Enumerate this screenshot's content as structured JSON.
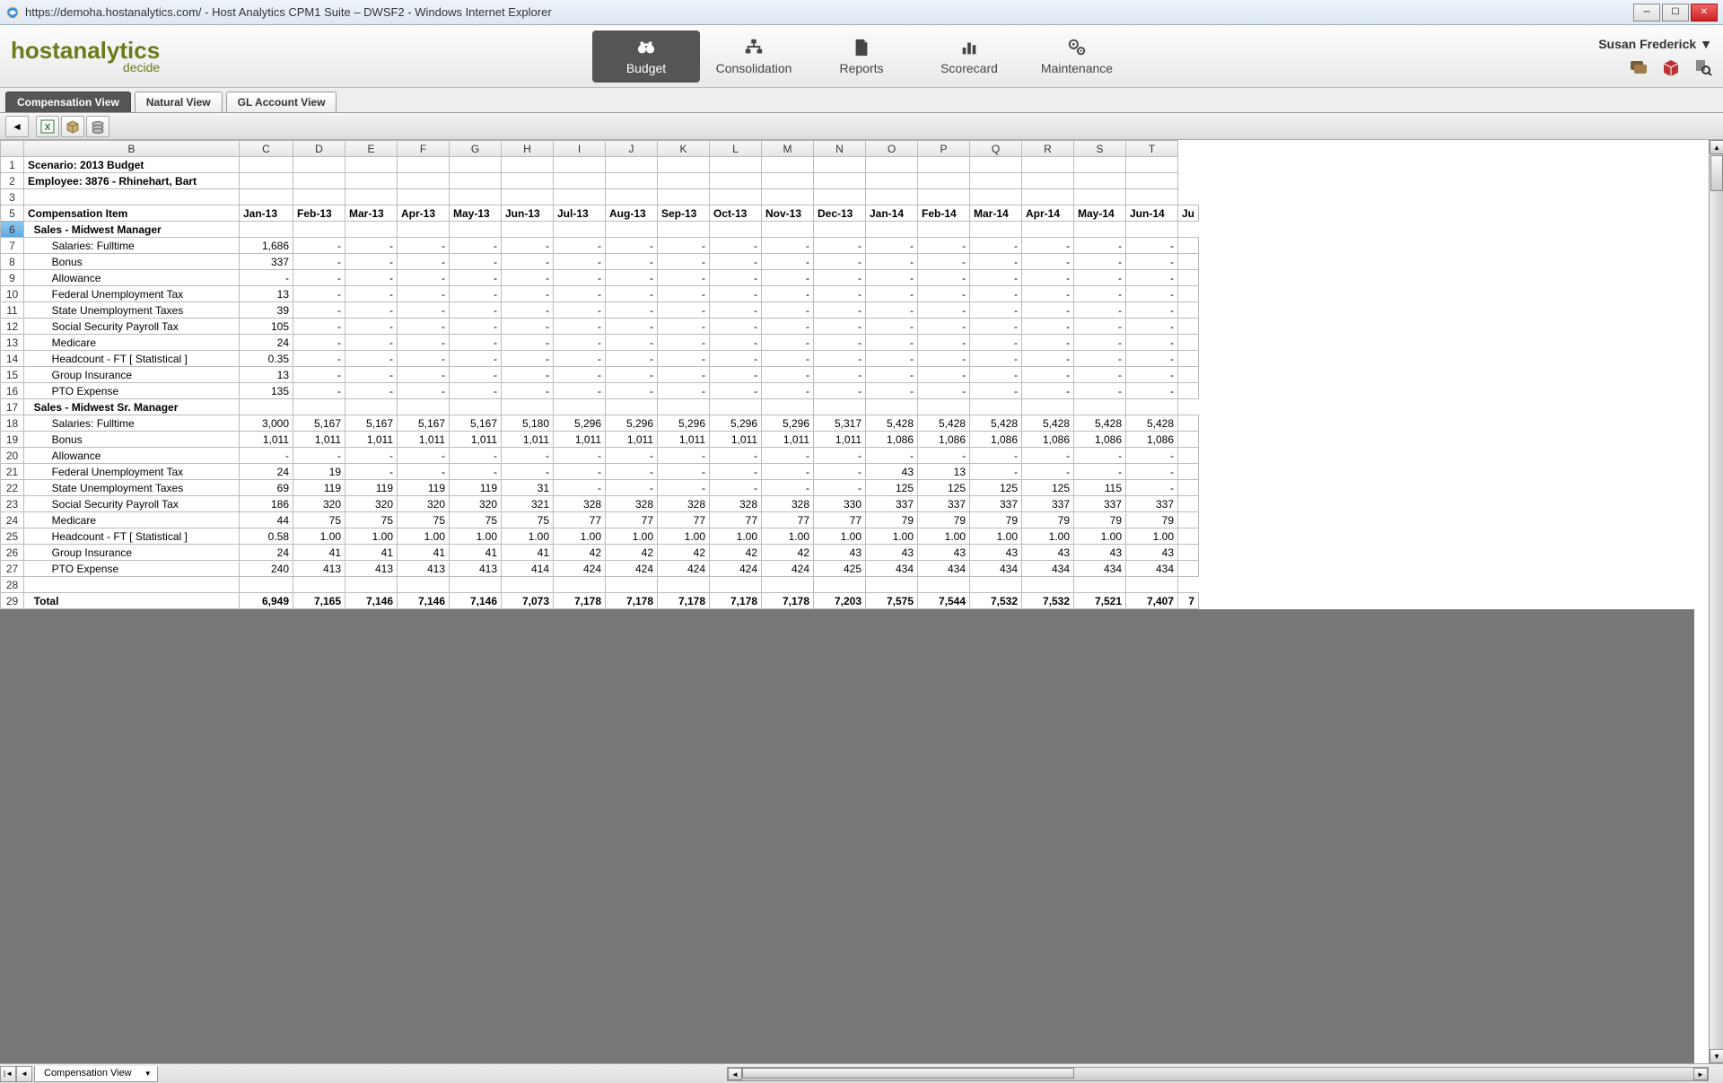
{
  "window": {
    "title": "https://demoha.hostanalytics.com/ - Host Analytics CPM1 Suite – DWSF2 - Windows Internet Explorer"
  },
  "logo": {
    "main": "hostanalytics",
    "sub": "decide"
  },
  "nav": {
    "items": [
      {
        "label": "Budget",
        "icon": "binoculars"
      },
      {
        "label": "Consolidation",
        "icon": "org"
      },
      {
        "label": "Reports",
        "icon": "doc"
      },
      {
        "label": "Scorecard",
        "icon": "chart"
      },
      {
        "label": "Maintenance",
        "icon": "gears"
      }
    ],
    "active": 0
  },
  "user": {
    "name": "Susan Frederick"
  },
  "tabs": {
    "items": [
      "Compensation View",
      "Natural View",
      "GL Account View"
    ],
    "active": 0
  },
  "sheet_tab": "Compensation View",
  "columns_letters": [
    "B",
    "C",
    "D",
    "E",
    "F",
    "G",
    "H",
    "I",
    "J",
    "K",
    "L",
    "M",
    "N",
    "O",
    "P",
    "Q",
    "R",
    "S",
    "T"
  ],
  "selected_col": "C",
  "months": [
    "Jan-13",
    "Feb-13",
    "Mar-13",
    "Apr-13",
    "May-13",
    "Jun-13",
    "Jul-13",
    "Aug-13",
    "Sep-13",
    "Oct-13",
    "Nov-13",
    "Dec-13",
    "Jan-14",
    "Feb-14",
    "Mar-14",
    "Apr-14",
    "May-14",
    "Jun-14",
    "Ju"
  ],
  "grid": {
    "row1": "Scenario: 2013 Budget",
    "row2": "Employee: 3876 - Rhinehart, Bart",
    "row5": "Compensation Item",
    "group1": "Sales - Midwest Manager",
    "group1_items": [
      {
        "n": 7,
        "label": "Salaries: Fulltime",
        "vals": [
          "1,686",
          "-",
          "-",
          "-",
          "-",
          "-",
          "-",
          "-",
          "-",
          "-",
          "-",
          "-",
          "-",
          "-",
          "-",
          "-",
          "-",
          "-",
          ""
        ]
      },
      {
        "n": 8,
        "label": "Bonus",
        "vals": [
          "337",
          "-",
          "-",
          "-",
          "-",
          "-",
          "-",
          "-",
          "-",
          "-",
          "-",
          "-",
          "-",
          "-",
          "-",
          "-",
          "-",
          "-",
          ""
        ]
      },
      {
        "n": 9,
        "label": "Allowance",
        "vals": [
          "-",
          "-",
          "-",
          "-",
          "-",
          "-",
          "-",
          "-",
          "-",
          "-",
          "-",
          "-",
          "-",
          "-",
          "-",
          "-",
          "-",
          "-",
          ""
        ]
      },
      {
        "n": 10,
        "label": "Federal Unemployment Tax",
        "vals": [
          "13",
          "-",
          "-",
          "-",
          "-",
          "-",
          "-",
          "-",
          "-",
          "-",
          "-",
          "-",
          "-",
          "-",
          "-",
          "-",
          "-",
          "-",
          ""
        ]
      },
      {
        "n": 11,
        "label": "State Unemployment Taxes",
        "vals": [
          "39",
          "-",
          "-",
          "-",
          "-",
          "-",
          "-",
          "-",
          "-",
          "-",
          "-",
          "-",
          "-",
          "-",
          "-",
          "-",
          "-",
          "-",
          ""
        ]
      },
      {
        "n": 12,
        "label": "Social Security Payroll Tax",
        "vals": [
          "105",
          "-",
          "-",
          "-",
          "-",
          "-",
          "-",
          "-",
          "-",
          "-",
          "-",
          "-",
          "-",
          "-",
          "-",
          "-",
          "-",
          "-",
          ""
        ]
      },
      {
        "n": 13,
        "label": "Medicare",
        "vals": [
          "24",
          "-",
          "-",
          "-",
          "-",
          "-",
          "-",
          "-",
          "-",
          "-",
          "-",
          "-",
          "-",
          "-",
          "-",
          "-",
          "-",
          "-",
          ""
        ]
      },
      {
        "n": 14,
        "label": "Headcount - FT  [ Statistical ]",
        "vals": [
          "0.35",
          "-",
          "-",
          "-",
          "-",
          "-",
          "-",
          "-",
          "-",
          "-",
          "-",
          "-",
          "-",
          "-",
          "-",
          "-",
          "-",
          "-",
          ""
        ]
      },
      {
        "n": 15,
        "label": "Group Insurance",
        "vals": [
          "13",
          "-",
          "-",
          "-",
          "-",
          "-",
          "-",
          "-",
          "-",
          "-",
          "-",
          "-",
          "-",
          "-",
          "-",
          "-",
          "-",
          "-",
          ""
        ]
      },
      {
        "n": 16,
        "label": "PTO Expense",
        "vals": [
          "135",
          "-",
          "-",
          "-",
          "-",
          "-",
          "-",
          "-",
          "-",
          "-",
          "-",
          "-",
          "-",
          "-",
          "-",
          "-",
          "-",
          "-",
          ""
        ]
      }
    ],
    "group2": "Sales - Midwest Sr. Manager",
    "group2_items": [
      {
        "n": 18,
        "label": "Salaries: Fulltime",
        "vals": [
          "3,000",
          "5,167",
          "5,167",
          "5,167",
          "5,167",
          "5,180",
          "5,296",
          "5,296",
          "5,296",
          "5,296",
          "5,296",
          "5,317",
          "5,428",
          "5,428",
          "5,428",
          "5,428",
          "5,428",
          "5,428",
          ""
        ]
      },
      {
        "n": 19,
        "label": "Bonus",
        "vals": [
          "1,011",
          "1,011",
          "1,011",
          "1,011",
          "1,011",
          "1,011",
          "1,011",
          "1,011",
          "1,011",
          "1,011",
          "1,011",
          "1,011",
          "1,086",
          "1,086",
          "1,086",
          "1,086",
          "1,086",
          "1,086",
          ""
        ]
      },
      {
        "n": 20,
        "label": "Allowance",
        "vals": [
          "-",
          "-",
          "-",
          "-",
          "-",
          "-",
          "-",
          "-",
          "-",
          "-",
          "-",
          "-",
          "-",
          "-",
          "-",
          "-",
          "-",
          "-",
          ""
        ]
      },
      {
        "n": 21,
        "label": "Federal Unemployment Tax",
        "vals": [
          "24",
          "19",
          "-",
          "-",
          "-",
          "-",
          "-",
          "-",
          "-",
          "-",
          "-",
          "-",
          "43",
          "13",
          "-",
          "-",
          "-",
          "-",
          ""
        ]
      },
      {
        "n": 22,
        "label": "State Unemployment Taxes",
        "vals": [
          "69",
          "119",
          "119",
          "119",
          "119",
          "31",
          "-",
          "-",
          "-",
          "-",
          "-",
          "-",
          "125",
          "125",
          "125",
          "125",
          "115",
          "-",
          ""
        ]
      },
      {
        "n": 23,
        "label": "Social Security Payroll Tax",
        "vals": [
          "186",
          "320",
          "320",
          "320",
          "320",
          "321",
          "328",
          "328",
          "328",
          "328",
          "328",
          "330",
          "337",
          "337",
          "337",
          "337",
          "337",
          "337",
          ""
        ]
      },
      {
        "n": 24,
        "label": "Medicare",
        "vals": [
          "44",
          "75",
          "75",
          "75",
          "75",
          "75",
          "77",
          "77",
          "77",
          "77",
          "77",
          "77",
          "79",
          "79",
          "79",
          "79",
          "79",
          "79",
          ""
        ]
      },
      {
        "n": 25,
        "label": "Headcount - FT  [ Statistical ]",
        "vals": [
          "0.58",
          "1.00",
          "1.00",
          "1.00",
          "1.00",
          "1.00",
          "1.00",
          "1.00",
          "1.00",
          "1.00",
          "1.00",
          "1.00",
          "1.00",
          "1.00",
          "1.00",
          "1.00",
          "1.00",
          "1.00",
          ""
        ]
      },
      {
        "n": 26,
        "label": "Group Insurance",
        "vals": [
          "24",
          "41",
          "41",
          "41",
          "41",
          "41",
          "42",
          "42",
          "42",
          "42",
          "42",
          "43",
          "43",
          "43",
          "43",
          "43",
          "43",
          "43",
          ""
        ]
      },
      {
        "n": 27,
        "label": "PTO Expense",
        "vals": [
          "240",
          "413",
          "413",
          "413",
          "413",
          "414",
          "424",
          "424",
          "424",
          "424",
          "424",
          "425",
          "434",
          "434",
          "434",
          "434",
          "434",
          "434",
          ""
        ]
      }
    ],
    "total_label": "Total",
    "total_vals": [
      "6,949",
      "7,165",
      "7,146",
      "7,146",
      "7,146",
      "7,073",
      "7,178",
      "7,178",
      "7,178",
      "7,178",
      "7,178",
      "7,203",
      "7,575",
      "7,544",
      "7,532",
      "7,532",
      "7,521",
      "7,407",
      "7"
    ]
  }
}
